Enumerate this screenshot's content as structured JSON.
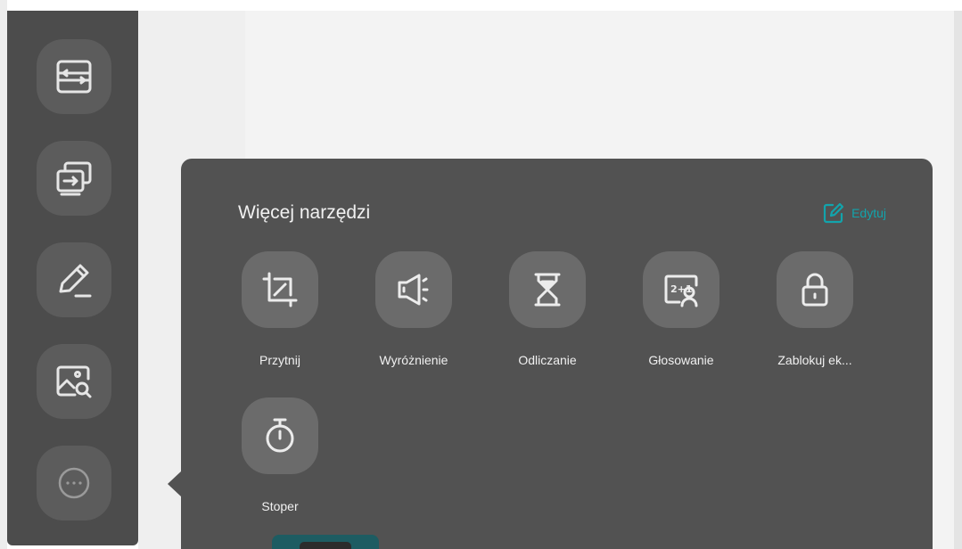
{
  "sidebar": {
    "buttons": [
      {
        "icon": "switch-icon"
      },
      {
        "icon": "screen-share-icon"
      },
      {
        "icon": "pencil-icon"
      },
      {
        "icon": "image-search-icon"
      },
      {
        "icon": "more-icon"
      }
    ]
  },
  "panel": {
    "title": "Więcej narzędzi",
    "edit_label": "Edytuj",
    "tools": [
      {
        "label": "Przytnij",
        "icon": "crop-icon"
      },
      {
        "label": "Wyróżnienie",
        "icon": "spotlight-icon"
      },
      {
        "label": "Odliczanie",
        "icon": "hourglass-icon"
      },
      {
        "label": "Głosowanie",
        "icon": "voting-icon"
      },
      {
        "label": "Zablokuj ek...",
        "icon": "lock-icon"
      },
      {
        "label": "Stoper",
        "icon": "stopwatch-icon"
      }
    ]
  },
  "colors": {
    "accent": "#12a4ac",
    "panel_bg": "#525252",
    "sidebar_bg": "#4c4c4c",
    "tile_bg": "#6b6b6b"
  }
}
